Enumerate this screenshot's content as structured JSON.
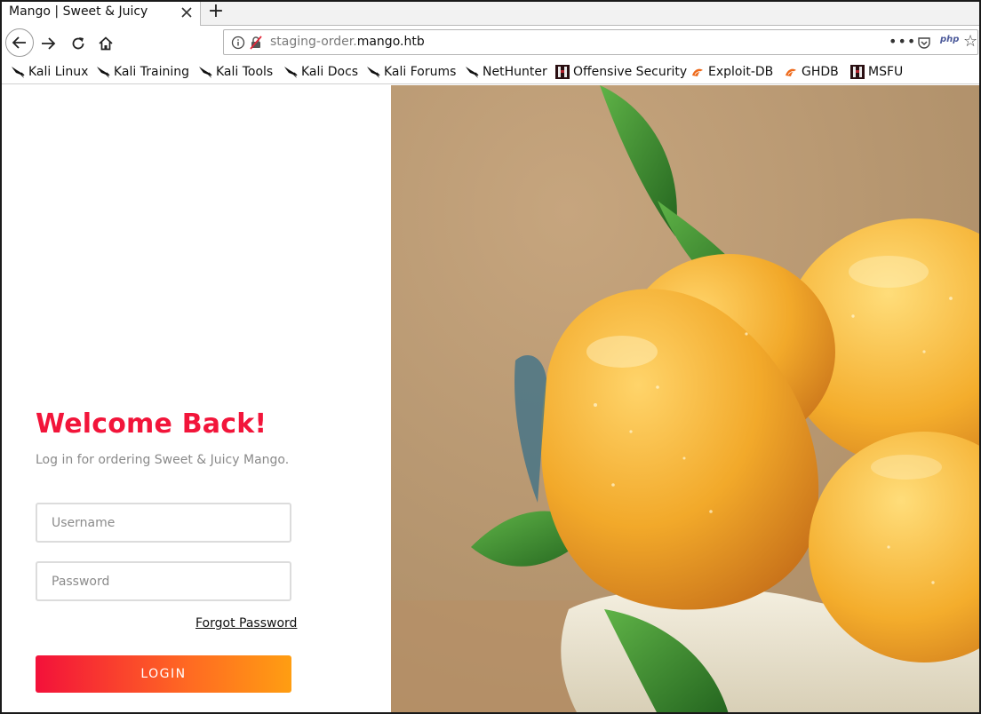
{
  "browser": {
    "tab_title": "Mango | Sweet & Juicy",
    "new_tab_label": "+",
    "url_subdomain": "staging-order.",
    "url_domain": "mango.htb",
    "more_label": "•••",
    "php_label": "php",
    "star_label": "☆"
  },
  "bookmarks": [
    {
      "label": "Kali Linux",
      "icon": "kali-dragon-icon"
    },
    {
      "label": "Kali Training",
      "icon": "kali-dragon-icon"
    },
    {
      "label": "Kali Tools",
      "icon": "kali-dragon-icon"
    },
    {
      "label": "Kali Docs",
      "icon": "kali-dragon-icon"
    },
    {
      "label": "Kali Forums",
      "icon": "kali-dragon-icon"
    },
    {
      "label": "NetHunter",
      "icon": "kali-dragon-icon"
    },
    {
      "label": "Offensive Security",
      "icon": "offsec-icon"
    },
    {
      "label": "Exploit-DB",
      "icon": "exploit-db-icon"
    },
    {
      "label": "GHDB",
      "icon": "exploit-db-icon"
    },
    {
      "label": "MSFU",
      "icon": "offsec-icon"
    }
  ],
  "login": {
    "heading": "Welcome Back!",
    "subtitle": "Log in for ordering Sweet & Juicy Mango.",
    "username_placeholder": "Username",
    "password_placeholder": "Password",
    "forgot_label": "Forgot Password",
    "login_label": "LOGIN"
  },
  "colors": {
    "accent": "#f2153a",
    "button_gradient_start": "#f3113a",
    "button_gradient_end": "#ff9e12",
    "mango": "#f2a82a",
    "leaf": "#3f8a2e"
  }
}
